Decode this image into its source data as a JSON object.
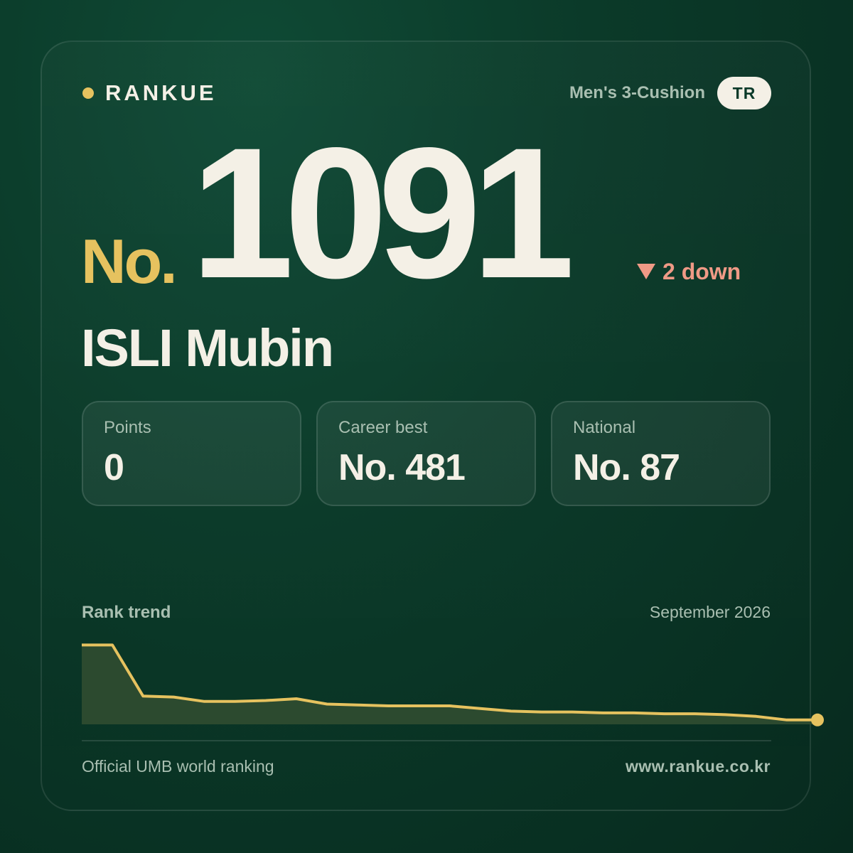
{
  "brand": {
    "name": "RANKUE",
    "dot_color": "#e6c25f"
  },
  "header": {
    "category": "Men's 3-Cushion",
    "country_code": "TR"
  },
  "rank": {
    "prefix": "No.",
    "number": "1091",
    "change_direction": "down",
    "change_label": "2 down",
    "change_icon": "triangle-down-icon",
    "change_color": "#ef9a86"
  },
  "player": {
    "name": "ISLI Mubin"
  },
  "stats": [
    {
      "label": "Points",
      "value": "0"
    },
    {
      "label": "Career best",
      "value": "No. 481"
    },
    {
      "label": "National",
      "value": "No. 87"
    }
  ],
  "trend": {
    "title": "Rank trend",
    "month": "September 2026"
  },
  "chart_data": {
    "type": "area",
    "title": "Rank trend",
    "xlabel": "",
    "ylabel": "",
    "grid": false,
    "line_color": "#e6c25f",
    "fill_color": "#2c4a2f",
    "values": [
      0.9,
      0.9,
      0.32,
      0.31,
      0.26,
      0.26,
      0.27,
      0.29,
      0.23,
      0.22,
      0.21,
      0.21,
      0.21,
      0.18,
      0.15,
      0.14,
      0.14,
      0.13,
      0.13,
      0.12,
      0.12,
      0.11,
      0.09,
      0.05,
      0.05
    ]
  },
  "footer": {
    "left": "Official UMB world ranking",
    "right": "www.rankue.co.kr"
  }
}
